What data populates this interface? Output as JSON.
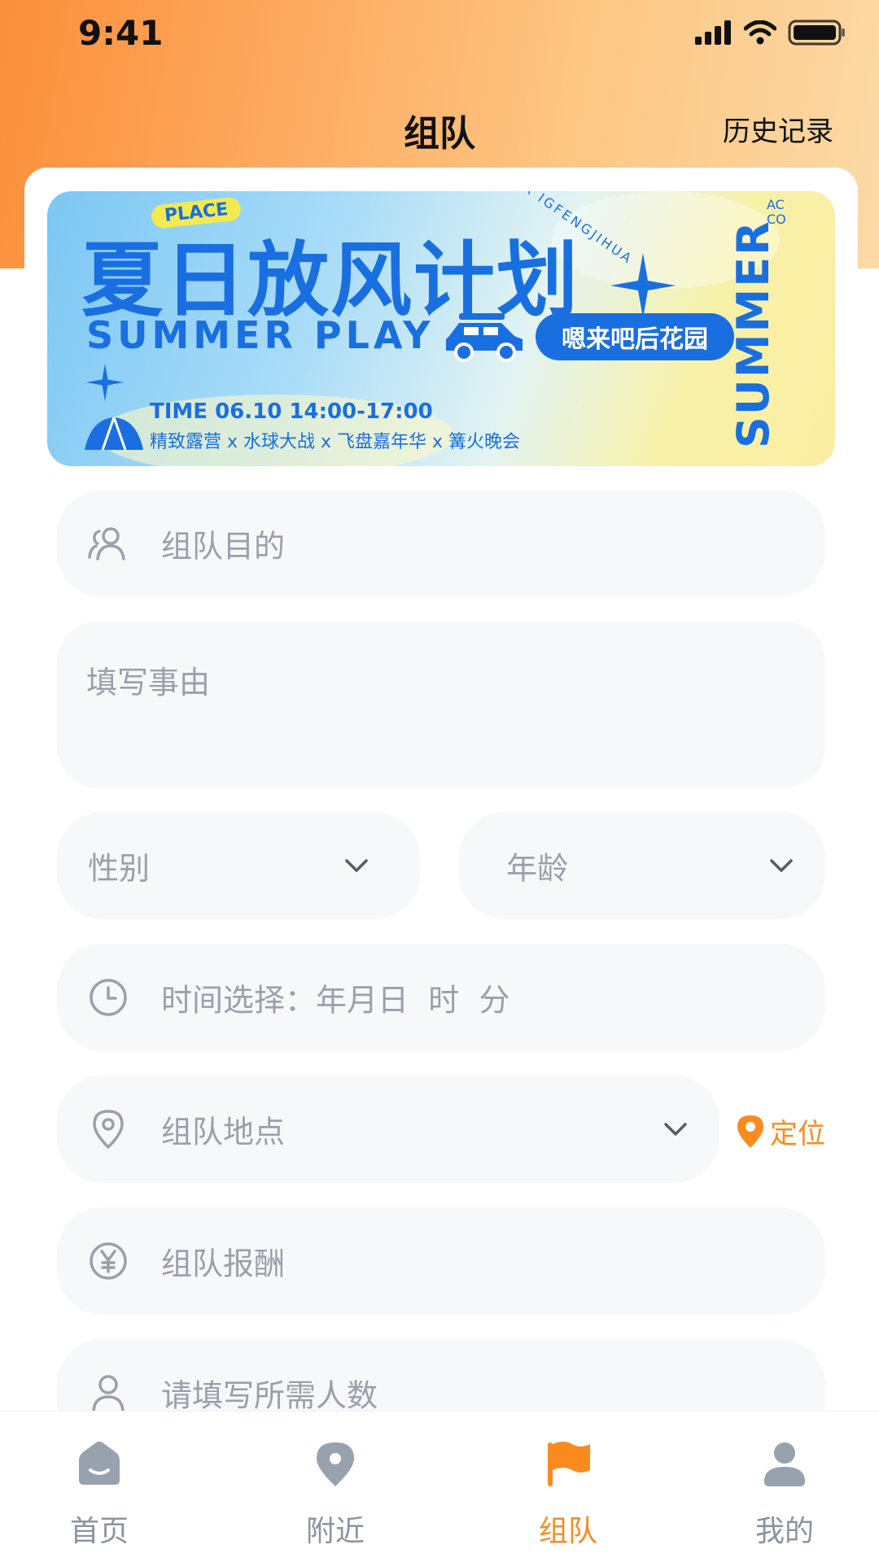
{
  "status_bar": {
    "time": "9:41"
  },
  "header": {
    "title": "组队",
    "history": "历史记录"
  },
  "banner": {
    "place_tag": "PLACE",
    "title_cn": "夏日放风计划",
    "title_en": "SUMMER PLAY",
    "venue": "嗯来吧后花园",
    "time": "TIME 06.10 14:00-17:00",
    "activities": "精致露营 x 水球大战 x 飞盘嘉年华 x 篝火晚会",
    "side_text": "SUMMER",
    "arc_text": "XIAR IGFENGJIHUA",
    "corner_text": "AC CO"
  },
  "form": {
    "purpose_placeholder": "组队目的",
    "reason_placeholder": "填写事由",
    "gender_placeholder": "性别",
    "age_placeholder": "年龄",
    "time_placeholder": "时间选择：年月日  时  分",
    "location_placeholder": "组队地点",
    "locate_label": "定位",
    "reward_placeholder": "组队报酬",
    "people_placeholder": "请填写所需人数"
  },
  "tabbar": {
    "items": [
      {
        "label": "首页",
        "icon": "home-icon"
      },
      {
        "label": "附近",
        "icon": "location-icon"
      },
      {
        "label": "组队",
        "icon": "flag-icon"
      },
      {
        "label": "我的",
        "icon": "user-icon"
      }
    ],
    "active_index": 2
  },
  "colors": {
    "accent": "#f98b1e",
    "field_bg": "#f7f8fa",
    "placeholder": "#9aa0ab",
    "banner_blue": "#1a73e8"
  }
}
